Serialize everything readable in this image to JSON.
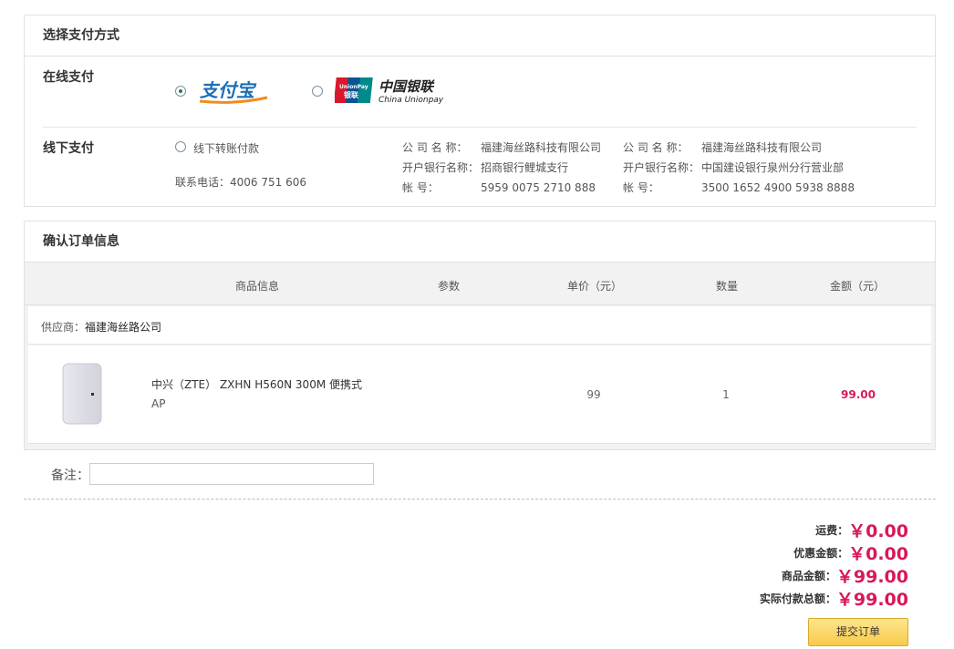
{
  "payment": {
    "title": "选择支付方式",
    "online_label": "在线支付",
    "offline_label": "线下支付",
    "alipay_text": "支付宝",
    "unionpay_cn": "中国银联",
    "unionpay_en": "China Unionpay",
    "unionpay_badge_top": "UnionPay",
    "unionpay_badge_bottom": "银联",
    "offline_option": "线下转账付款",
    "phone": "联系电话：4006 751 606",
    "bank1": {
      "company_key": "公 司 名 称：",
      "company": "福建海丝路科技有限公司",
      "bank_key": "开户银行名称：",
      "bank": "招商银行鲤城支行",
      "account_key": "帐          号：",
      "account": "5959 0075 2710 888"
    },
    "bank2": {
      "company_key": "公 司 名 称：",
      "company": "福建海丝路科技有限公司",
      "bank_key": "开户银行名称：",
      "bank": "中国建设银行泉州分行营业部",
      "account_key": "帐          号：",
      "account": "3500 1652 4900 5938 8888"
    }
  },
  "order": {
    "title": "确认订单信息",
    "columns": [
      "商品信息",
      "参数",
      "单价（元）",
      "数量",
      "金额（元）"
    ],
    "supplier_prefix": "供应商：",
    "supplier": "福建海丝路公司",
    "item": {
      "name_line1": "中兴（ZTE） ZXHN H560N 300M 便携式",
      "name_line2": "AP",
      "unit_price": "99",
      "quantity": "1",
      "amount": "99.00"
    }
  },
  "remark": {
    "label": "备注：",
    "value": ""
  },
  "summary": {
    "shipping_label": "运费：",
    "shipping": "￥0.00",
    "discount_label": "优惠金额：",
    "discount": "￥0.00",
    "goods_label": "商品金额：",
    "goods": "￥99.00",
    "total_label": "实际付款总额：",
    "total": "￥99.00"
  },
  "submit_label": "提交订单",
  "colors": {
    "accent": "#d8185c",
    "button": "#f7cb4a"
  }
}
